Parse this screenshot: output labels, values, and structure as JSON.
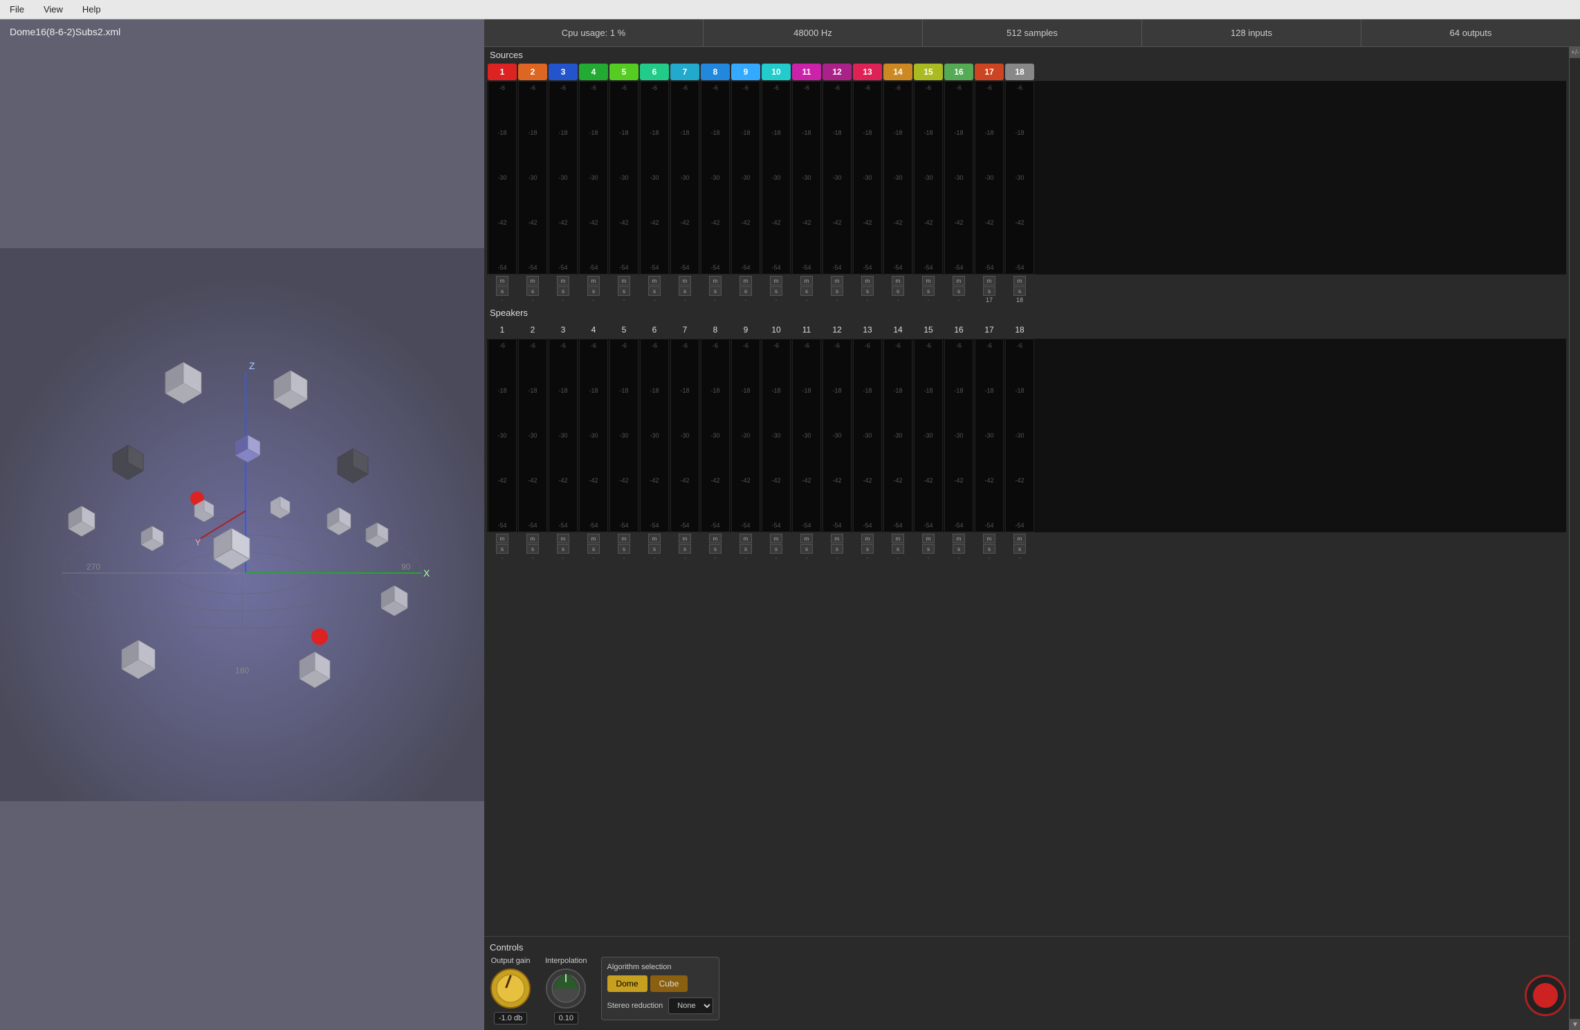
{
  "menubar": {
    "items": [
      "File",
      "View",
      "Help"
    ]
  },
  "filelabel": "Dome16(8-6-2)Subs2.xml",
  "statusbar": {
    "cpu": "Cpu usage: 1 %",
    "hz": "48000 Hz",
    "samples": "512 samples",
    "inputs": "128 inputs",
    "outputs": "64 outputs"
  },
  "sources": {
    "title": "Sources",
    "channels": [
      {
        "num": "1",
        "color": "#dd2222"
      },
      {
        "num": "2",
        "color": "#dd6622"
      },
      {
        "num": "3",
        "color": "#2255cc"
      },
      {
        "num": "4",
        "color": "#22aa33"
      },
      {
        "num": "5",
        "color": "#55cc22"
      },
      {
        "num": "6",
        "color": "#22cc88"
      },
      {
        "num": "7",
        "color": "#22aacc"
      },
      {
        "num": "8",
        "color": "#2288dd"
      },
      {
        "num": "9",
        "color": "#33aaff"
      },
      {
        "num": "10",
        "color": "#22cccc"
      },
      {
        "num": "11",
        "color": "#cc22aa"
      },
      {
        "num": "12",
        "color": "#aa2288"
      },
      {
        "num": "13",
        "color": "#dd2255"
      },
      {
        "num": "14",
        "color": "#cc8822"
      },
      {
        "num": "15",
        "color": "#aabb22"
      },
      {
        "num": "16",
        "color": "#55aa55"
      },
      {
        "num": "17",
        "color": "#cc4422"
      },
      {
        "num": "18",
        "color": "#888888"
      }
    ],
    "vu_labels": [
      "-6",
      "-18",
      "-30",
      "-42",
      "-54"
    ],
    "ms_special": [
      "17",
      "18"
    ]
  },
  "speakers": {
    "title": "Speakers",
    "channels": [
      1,
      2,
      3,
      4,
      5,
      6,
      7,
      8,
      9,
      10,
      11,
      12,
      13,
      14,
      15,
      16,
      17,
      18
    ],
    "vu_labels": [
      "-6",
      "-18",
      "-30",
      "-42",
      "-54"
    ]
  },
  "controls": {
    "title": "Controls",
    "output_gain_label": "Output gain",
    "output_gain_value": "-1.0 db",
    "interpolation_label": "Interpolation",
    "interpolation_value": "0.10",
    "algorithm_title": "Algorithm selection",
    "algo_dome": "Dome",
    "algo_cube": "Cube",
    "stereo_label": "Stereo reduction",
    "stereo_options": [
      "None"
    ],
    "stereo_selected": "None",
    "scroll_plus_minus": "+/-"
  }
}
